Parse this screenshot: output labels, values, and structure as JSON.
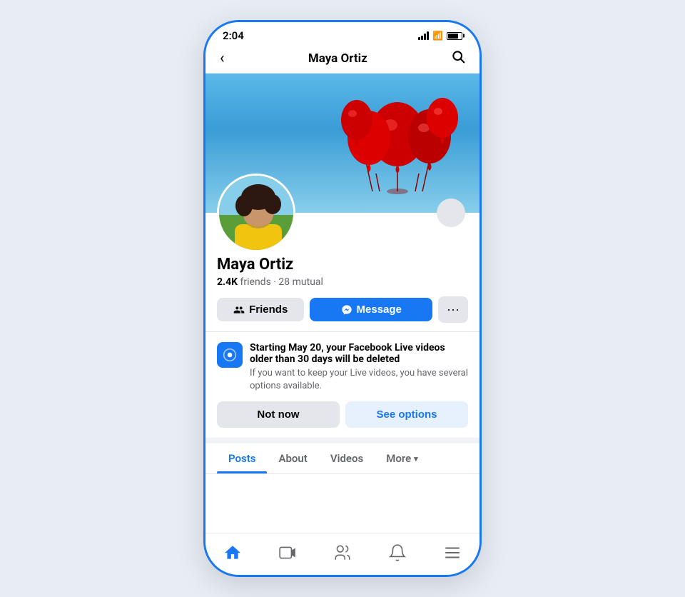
{
  "statusBar": {
    "time": "2:04",
    "batteryLevel": 80
  },
  "navBar": {
    "title": "Maya Ortiz",
    "backLabel": "‹",
    "searchLabel": "🔍"
  },
  "profile": {
    "name": "Maya Ortiz",
    "friends": "2.4K",
    "mutual": "28",
    "metaText": "friends · 28 mutual",
    "friendsLabel": "Friends",
    "messageLabel": "Message",
    "moreDotsLabel": "···"
  },
  "notification": {
    "title": "Starting May 20, your Facebook Live videos older than 30 days will be deleted",
    "body": "If you want to keep your Live videos, you have several options available.",
    "notNowLabel": "Not now",
    "seeOptionsLabel": "See options"
  },
  "tabs": [
    {
      "label": "Posts",
      "active": true
    },
    {
      "label": "About",
      "active": false
    },
    {
      "label": "Videos",
      "active": false
    },
    {
      "label": "More",
      "active": false
    }
  ],
  "bottomNav": [
    {
      "label": "home",
      "icon": "⌂",
      "active": true
    },
    {
      "label": "video",
      "icon": "▷",
      "active": false
    },
    {
      "label": "people",
      "icon": "◎",
      "active": false
    },
    {
      "label": "bell",
      "icon": "🔔",
      "active": false
    },
    {
      "label": "menu",
      "icon": "☰",
      "active": false
    }
  ]
}
